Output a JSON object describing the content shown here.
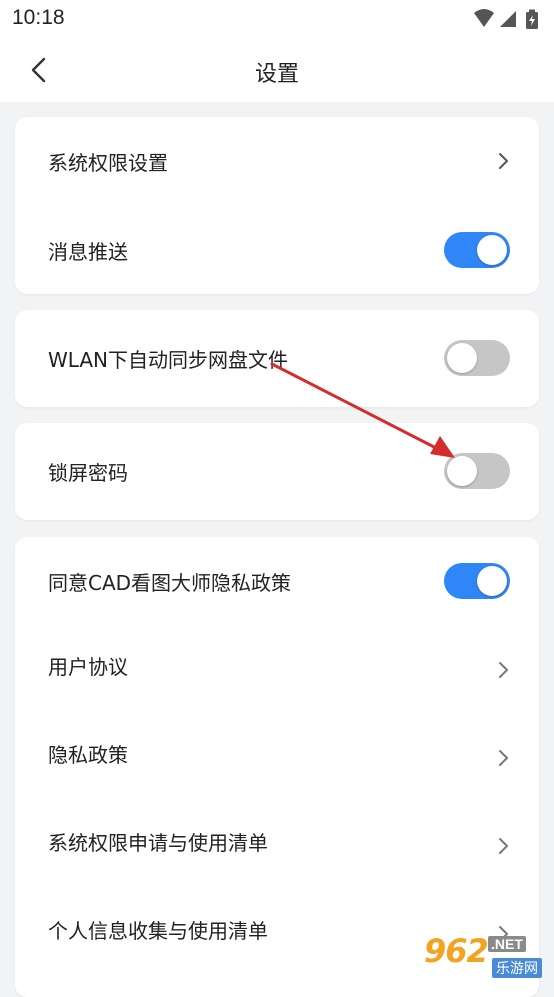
{
  "status_bar": {
    "time": "10:18",
    "icons": [
      "wifi-icon",
      "cell-signal-icon",
      "battery-charging-icon"
    ]
  },
  "header": {
    "title": "设置",
    "back_icon": "chevron-left-icon"
  },
  "cards": {
    "card1": {
      "system_permission": {
        "label": "系统权限设置",
        "icon": "chevron-right-icon"
      },
      "push": {
        "label": "消息推送",
        "enabled": true
      }
    },
    "card2": {
      "wlan_sync": {
        "label": "WLAN下自动同步网盘文件",
        "enabled": false
      }
    },
    "card3": {
      "lock_password": {
        "label": "锁屏密码",
        "enabled": false
      }
    },
    "card4": {
      "privacy_consent": {
        "label": "同意CAD看图大师隐私政策",
        "enabled": true
      },
      "user_agreement": {
        "label": "用户协议",
        "icon": "chevron-right-icon"
      },
      "privacy_policy": {
        "label": "隐私政策",
        "icon": "chevron-right-icon"
      },
      "permission_list": {
        "label": "系统权限申请与使用清单",
        "icon": "chevron-right-icon"
      },
      "personal_info_list": {
        "label": "个人信息收集与使用清单",
        "icon": "chevron-right-icon"
      }
    }
  },
  "annotation": {
    "arrow_color": "#d62c2c"
  },
  "watermark": {
    "main": "962",
    "tld": ".NET",
    "sub": "乐游网"
  },
  "colors": {
    "toggle_on": "#2f86f6",
    "toggle_off": "#c6c6c6",
    "background": "#f2f3f5",
    "card": "#ffffff"
  }
}
